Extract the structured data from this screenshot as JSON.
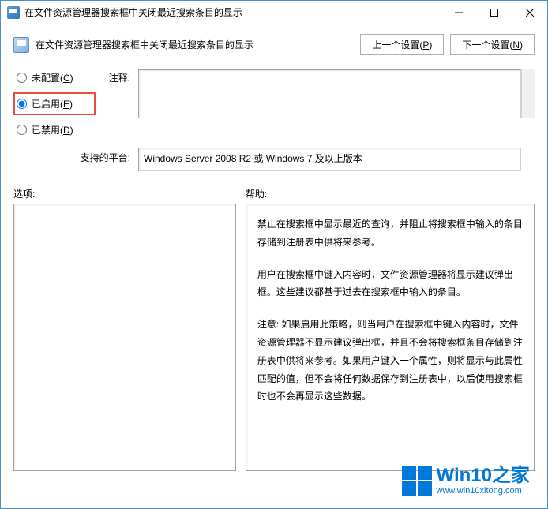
{
  "titlebar": {
    "title": "在文件资源管理器搜索框中关闭最近搜索条目的显示"
  },
  "header": {
    "policy_title": "在文件资源管理器搜索框中关闭最近搜索条目的显示",
    "prev_button": "上一个设置(",
    "prev_key": "P",
    "next_button": "下一个设置(",
    "next_key": "N",
    "button_suffix": ")"
  },
  "radios": {
    "not_configured": "未配置(",
    "not_configured_key": "C",
    "enabled": "已启用(",
    "enabled_key": "E",
    "disabled": "已禁用(",
    "disabled_key": "D",
    "suffix": ")"
  },
  "comment": {
    "label": "注释:",
    "value": ""
  },
  "platform": {
    "label": "支持的平台:",
    "value": "Windows Server 2008 R2 或 Windows 7 及以上版本"
  },
  "panels": {
    "options_label": "选项:",
    "help_label": "帮助:"
  },
  "help": {
    "p1": "禁止在搜索框中显示最近的查询，并阻止将搜索框中输入的条目存储到注册表中供将来参考。",
    "p2": "用户在搜索框中键入内容时，文件资源管理器将显示建议弹出框。这些建议都基于过去在搜索框中输入的条目。",
    "p3": "注意: 如果启用此策略，则当用户在搜索框中键入内容时，文件资源管理器不显示建议弹出框，并且不会将搜索框条目存储到注册表中供将来参考。如果用户键入一个属性，则将显示与此属性匹配的值，但不会将任何数据保存到注册表中，以后使用搜索框时也不会再显示这些数据。"
  },
  "watermark": {
    "brand": "Win10之家",
    "url": "www.win10xitong.com"
  }
}
